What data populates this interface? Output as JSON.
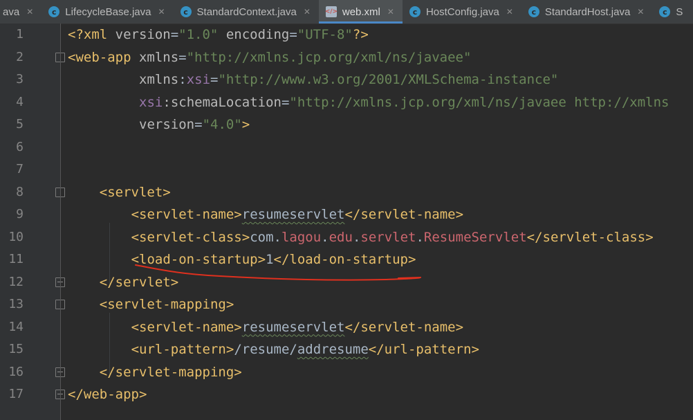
{
  "tabs": [
    {
      "name": "ava",
      "icon": "",
      "active": false
    },
    {
      "name": "LifecycleBase.java",
      "icon": "class-icon",
      "active": false
    },
    {
      "name": "StandardContext.java",
      "icon": "class-icon",
      "active": false
    },
    {
      "name": "web.xml",
      "icon": "xml-file-icon",
      "active": true
    },
    {
      "name": "HostConfig.java",
      "icon": "class-icon",
      "active": false
    },
    {
      "name": "StandardHost.java",
      "icon": "class-icon",
      "active": false
    },
    {
      "name": "S",
      "icon": "class-icon",
      "active": false
    }
  ],
  "colors": {
    "background": "#2b2b2b",
    "gutter": "#313335",
    "tag": "#e8bf6a",
    "attribute_value": "#6a8759",
    "namespace": "#9876aa",
    "annotation_stroke": "#e0301e"
  },
  "editor": {
    "line_numbers": [
      "1",
      "2",
      "3",
      "4",
      "5",
      "6",
      "7",
      "8",
      "9",
      "10",
      "11",
      "12",
      "13",
      "14",
      "15",
      "16",
      "17"
    ],
    "lines": [
      {
        "n": 1,
        "indent": 0,
        "fold": null,
        "tokens": [
          {
            "text": "<?xml ",
            "cls": "t-tag"
          },
          {
            "text": "version",
            "cls": "t-attr"
          },
          {
            "text": "=",
            "cls": "t-text"
          },
          {
            "text": "\"1.0\"",
            "cls": "t-val"
          },
          {
            "text": " ",
            "cls": "t-text"
          },
          {
            "text": "encoding",
            "cls": "t-attr"
          },
          {
            "text": "=",
            "cls": "t-text"
          },
          {
            "text": "\"UTF-8\"",
            "cls": "t-val"
          },
          {
            "text": "?>",
            "cls": "t-tag"
          }
        ]
      },
      {
        "n": 2,
        "indent": 0,
        "fold": "open",
        "tokens": [
          {
            "text": "<web-app ",
            "cls": "t-tag"
          },
          {
            "text": "xmlns",
            "cls": "t-attr"
          },
          {
            "text": "=",
            "cls": "t-text"
          },
          {
            "text": "\"http://xmlns.jcp.org/xml/ns/javaee\"",
            "cls": "t-val"
          }
        ]
      },
      {
        "n": 3,
        "indent": 9,
        "fold": null,
        "tokens": [
          {
            "text": "xmlns",
            "cls": "t-attr"
          },
          {
            "text": ":",
            "cls": "t-text"
          },
          {
            "text": "xsi",
            "cls": "t-ns"
          },
          {
            "text": "=",
            "cls": "t-text"
          },
          {
            "text": "\"http://www.w3.org/2001/XMLSchema-instance\"",
            "cls": "t-val"
          }
        ]
      },
      {
        "n": 4,
        "indent": 9,
        "fold": null,
        "tokens": [
          {
            "text": "xsi",
            "cls": "t-ns"
          },
          {
            "text": ":schemaLocation",
            "cls": "t-attr"
          },
          {
            "text": "=",
            "cls": "t-text"
          },
          {
            "text": "\"http://xmlns.jcp.org/xml/ns/javaee http://xmlns",
            "cls": "t-val"
          }
        ]
      },
      {
        "n": 5,
        "indent": 9,
        "fold": null,
        "tokens": [
          {
            "text": "version",
            "cls": "t-attr"
          },
          {
            "text": "=",
            "cls": "t-text"
          },
          {
            "text": "\"4.0\"",
            "cls": "t-val"
          },
          {
            "text": ">",
            "cls": "t-tag"
          }
        ]
      },
      {
        "n": 6,
        "indent": 0,
        "fold": null,
        "tokens": []
      },
      {
        "n": 7,
        "indent": 0,
        "fold": null,
        "tokens": []
      },
      {
        "n": 8,
        "indent": 4,
        "fold": "open",
        "tokens": [
          {
            "text": "<servlet>",
            "cls": "t-tag"
          }
        ]
      },
      {
        "n": 9,
        "indent": 8,
        "fold": null,
        "tokens": [
          {
            "text": "<servlet-name>",
            "cls": "t-tag"
          },
          {
            "text": "resumeservlet",
            "cls": "t-text squig"
          },
          {
            "text": "</servlet-name>",
            "cls": "t-tag"
          }
        ]
      },
      {
        "n": 10,
        "indent": 8,
        "fold": null,
        "tokens": [
          {
            "text": "<servlet-class>",
            "cls": "t-tag"
          },
          {
            "text": "com.",
            "cls": "t-text"
          },
          {
            "text": "lagou",
            "cls": "t-red"
          },
          {
            "text": ".",
            "cls": "t-text"
          },
          {
            "text": "edu",
            "cls": "t-red"
          },
          {
            "text": ".",
            "cls": "t-text"
          },
          {
            "text": "servlet",
            "cls": "t-red"
          },
          {
            "text": ".",
            "cls": "t-text"
          },
          {
            "text": "ResumeServlet",
            "cls": "t-red"
          },
          {
            "text": "</servlet-class>",
            "cls": "t-tag"
          }
        ]
      },
      {
        "n": 11,
        "indent": 8,
        "fold": null,
        "tokens": [
          {
            "text": "<load-on-startup>",
            "cls": "t-tag"
          },
          {
            "text": "1",
            "cls": "t-text"
          },
          {
            "text": "</load-on-startup>",
            "cls": "t-tag"
          }
        ]
      },
      {
        "n": 12,
        "indent": 4,
        "fold": "end",
        "tokens": [
          {
            "text": "</servlet>",
            "cls": "t-tag"
          }
        ]
      },
      {
        "n": 13,
        "indent": 4,
        "fold": "open",
        "tokens": [
          {
            "text": "<servlet-mapping>",
            "cls": "t-tag"
          }
        ]
      },
      {
        "n": 14,
        "indent": 8,
        "fold": null,
        "tokens": [
          {
            "text": "<servlet-name>",
            "cls": "t-tag"
          },
          {
            "text": "resumeservlet",
            "cls": "t-text squig"
          },
          {
            "text": "</servlet-name>",
            "cls": "t-tag"
          }
        ]
      },
      {
        "n": 15,
        "indent": 8,
        "fold": null,
        "tokens": [
          {
            "text": "<url-pattern>",
            "cls": "t-tag"
          },
          {
            "text": "/resume/",
            "cls": "t-text"
          },
          {
            "text": "addresume",
            "cls": "t-text squig"
          },
          {
            "text": "</url-pattern>",
            "cls": "t-tag"
          }
        ]
      },
      {
        "n": 16,
        "indent": 4,
        "fold": "end",
        "tokens": [
          {
            "text": "</servlet-mapping>",
            "cls": "t-tag"
          }
        ]
      },
      {
        "n": 17,
        "indent": 0,
        "fold": "end",
        "tokens": [
          {
            "text": "</web-app>",
            "cls": "t-tag"
          }
        ]
      }
    ]
  }
}
